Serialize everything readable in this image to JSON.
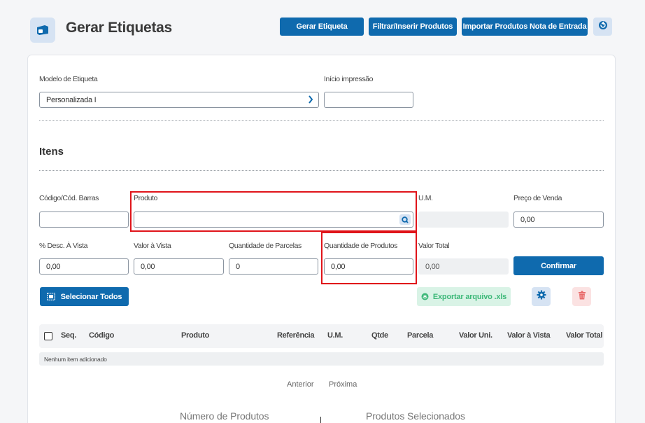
{
  "header": {
    "title": "Gerar Etiquetas",
    "buttons": [
      "Gerar Etiqueta",
      "Filtrar/Inserir Produtos",
      "Importar Produtos Nota de Entrada"
    ]
  },
  "form": {
    "modelo_label": "Modelo de Etiqueta",
    "modelo_value": "Personalizada I",
    "inicio_label": "Início impressão",
    "inicio_value": ""
  },
  "itens": {
    "title": "Itens",
    "codigo_label": "Código/Cód. Barras",
    "produto_label": "Produto",
    "um_label": "U.M.",
    "preco_label": "Preço de Venda",
    "preco_value": "0,00",
    "desc_label": "% Desc. À Vista",
    "desc_value": "0,00",
    "valor_vista_label": "Valor à Vista",
    "valor_vista_value": "0,00",
    "parcelas_label": "Quantidade de Parcelas",
    "parcelas_value": "0",
    "qtd_label": "Quantidade de Produtos",
    "qtd_value": "0,00",
    "valor_total_label": "Valor Total",
    "valor_total_value": "0,00",
    "confirm_label": "Confirmar"
  },
  "actions": {
    "select_all": "Selecionar Todos",
    "export": "Exportar arquivo .xls"
  },
  "table": {
    "columns": [
      "Seq.",
      "Código",
      "Produto",
      "Referência",
      "U.M.",
      "Qtde",
      "Parcela",
      "Valor Uni.",
      "Valor à Vista",
      "Valor Total"
    ],
    "empty": "Nenhum item adicionado"
  },
  "pagination": {
    "prev": "Anterior",
    "next": "Próxima"
  },
  "stats": {
    "numero": "Número de Produtos",
    "selecionados": "Produtos Selecionados"
  },
  "colors": {
    "primary": "#0f6aae",
    "highlight": "#e0141a",
    "export_bg": "#d9f3e6",
    "export_fg": "#3cb878",
    "delete_bg": "#fbe2e2",
    "delete_fg": "#e86a6a"
  }
}
